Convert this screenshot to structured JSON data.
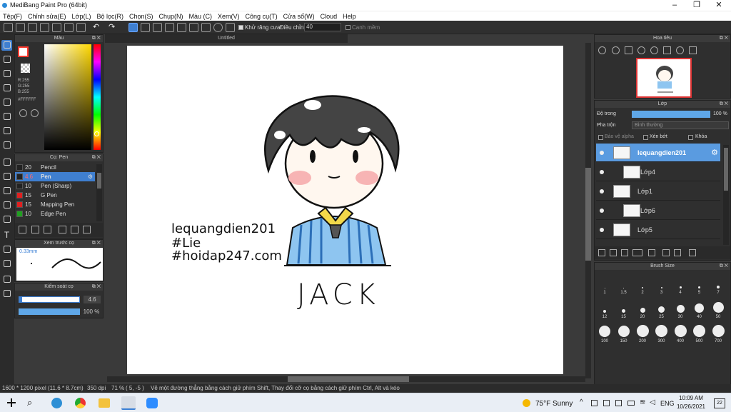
{
  "window": {
    "title": "MediBang Paint Pro (64bit)"
  },
  "menu": [
    "Tệp(F)",
    "Chỉnh sửa(E)",
    "Lớp(L)",
    "Bộ lọc(R)",
    "Chọn(S)",
    "Chụp(N)",
    "Màu (C)",
    "Xem(V)",
    "Công cụ(T)",
    "Cửa sổ(W)",
    "Cloud",
    "Help"
  ],
  "toolbar": {
    "antialias_label": "Khử răng cưa",
    "correction_label": "Điều chỉnh",
    "correction_value": "40",
    "smooth_label": "Canh mềm"
  },
  "color_panel": {
    "title": "Màu",
    "r": "R:255",
    "g": "G:255",
    "b": "B:255",
    "hex": "#FFFFFF",
    "accent": "#ff3b30"
  },
  "brush_panel": {
    "title": "Cọ: Pen",
    "items": [
      {
        "size": "20",
        "name": "Pencil",
        "color": "#222222"
      },
      {
        "size": "4.6",
        "name": "Pen",
        "color": "#222222"
      },
      {
        "size": "10",
        "name": "Pen (Sharp)",
        "color": "#222222"
      },
      {
        "size": "15",
        "name": "G Pen",
        "color": "#e02020"
      },
      {
        "size": "15",
        "name": "Mapping Pen",
        "color": "#e02020"
      },
      {
        "size": "10",
        "name": "Edge Pen",
        "color": "#20a020"
      }
    ]
  },
  "preview_panel": {
    "title": "Xem trước cọ",
    "size": "0.33mm"
  },
  "control_panel": {
    "title": "Kiểm soát cọ",
    "size_value": "4.6",
    "opacity_value": "100 %",
    "opacity_fraction": 1.0
  },
  "canvas": {
    "tab_title": "Untitled",
    "text_lines": [
      "lequangdien201",
      "#Lie",
      "#hoidap247.com"
    ],
    "name_label": "JACK"
  },
  "navigator": {
    "title": "Hoa tiêu"
  },
  "layer_panel": {
    "title": "Lớp",
    "opacity_label": "Độ trong",
    "opacity_value": "100 %",
    "opacity_fraction": 1.0,
    "blend_label": "Pha trộn",
    "blend_value": "Bình thường",
    "protect_alpha": "Bảo vệ alpha",
    "clip": "Xén bớt",
    "lock": "Khóa",
    "layers": [
      {
        "name": "lequangdien201",
        "selected": true
      },
      {
        "name": "Lớp4",
        "selected": false
      },
      {
        "name": "Lớp1",
        "selected": false
      },
      {
        "name": "Lớp6",
        "selected": false
      },
      {
        "name": "Lớp5",
        "selected": false
      }
    ]
  },
  "brush_size": {
    "title": "Brush Size",
    "values": [
      "1",
      "1.5",
      "2",
      "3",
      "4",
      "5",
      "7",
      "12",
      "15",
      "20",
      "25",
      "30",
      "40",
      "50",
      "100",
      "150",
      "200",
      "300",
      "400",
      "500",
      "700"
    ]
  },
  "status": {
    "dimensions": "1600 * 1200 pixel",
    "physical": "(11.6 * 8.7cm)",
    "dpi": "350 dpi",
    "zoom": "71 %",
    "coords": "( 5, -5 )",
    "hint": "Vẽ một đường thẳng bằng cách giữ phím Shift, Thay đổi cỡ cọ bằng cách giữ phím Ctrl, Alt và kéo"
  },
  "taskbar": {
    "weather": "75°F  Sunny",
    "lang": "ENG",
    "time": "10:09 AM",
    "date": "10/26/2021",
    "badge": "22"
  }
}
